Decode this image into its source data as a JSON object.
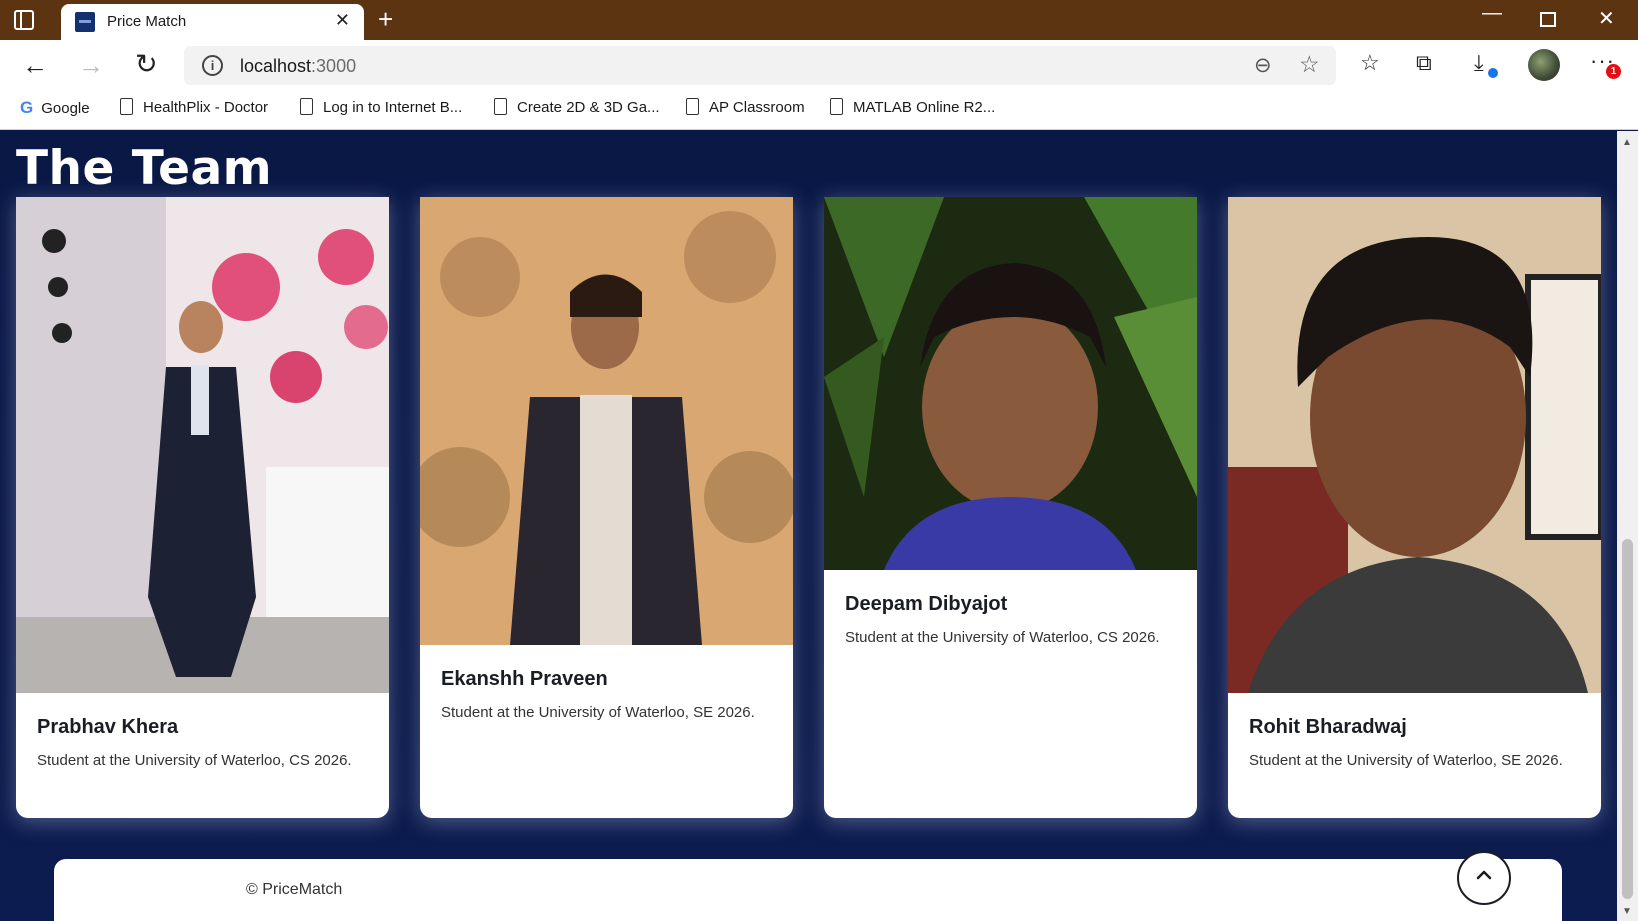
{
  "browser": {
    "tab_title": "Price Match",
    "url_host": "localhost",
    "url_port": ":3000",
    "bookmarks": [
      {
        "label": "Google",
        "icon": "google-icon"
      },
      {
        "label": "HealthPlix - Doctor",
        "icon": "page-icon"
      },
      {
        "label": "Log in to Internet B...",
        "icon": "page-icon"
      },
      {
        "label": "Create 2D & 3D Ga...",
        "icon": "page-icon"
      },
      {
        "label": "AP Classroom",
        "icon": "page-icon"
      },
      {
        "label": "MATLAB Online R2...",
        "icon": "page-icon"
      }
    ],
    "menu_badge": "1"
  },
  "section": {
    "title": "The Team"
  },
  "team": [
    {
      "name": "Prabhav Khera",
      "description": "Student at the University of Waterloo, CS 2026."
    },
    {
      "name": "Ekanshh Praveen",
      "description": "Student at the University of Waterloo, SE 2026."
    },
    {
      "name": "Deepam Dibyajot",
      "description": "Student at the University of Waterloo, CS 2026."
    },
    {
      "name": "Rohit Bharadwaj",
      "description": "Student at the University of Waterloo, SE 2026."
    }
  ],
  "footer": {
    "copyright": "© PriceMatch"
  },
  "colors": {
    "page_background": "#0b1744",
    "titlebar": "#5c3412",
    "card_background": "#ffffff"
  }
}
